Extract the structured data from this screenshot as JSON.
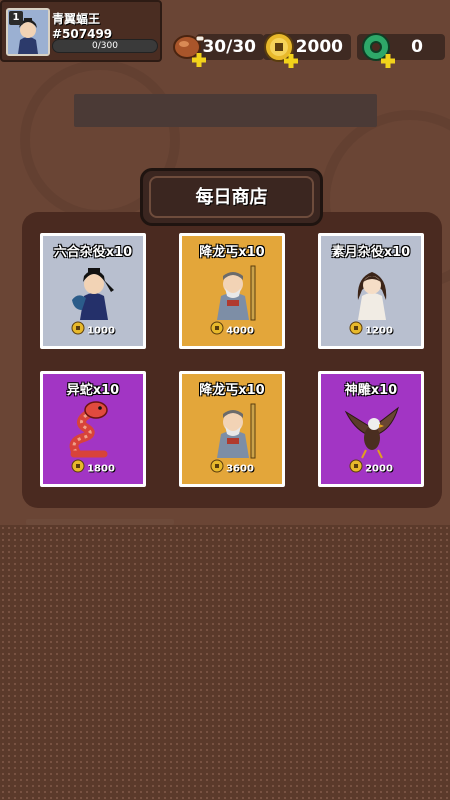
{
  "player": {
    "level": "1",
    "name": "青翼蝠王#507499",
    "xp_text": "0/300",
    "xp_progress": 0
  },
  "resources": {
    "stamina": {
      "icon": "meat-icon",
      "value": "30/30"
    },
    "coins": {
      "icon": "coin-icon",
      "value": "2000"
    },
    "gems": {
      "icon": "jade-icon",
      "value": "0"
    }
  },
  "shop": {
    "title": "每日商店",
    "items": [
      {
        "name": "六合杂役x10",
        "price": "1000",
        "rarity": "gray",
        "art": "swordsman-icon"
      },
      {
        "name": "降龙丐x10",
        "price": "4000",
        "rarity": "gold",
        "art": "beggar-elder-icon"
      },
      {
        "name": "素月杂役x10",
        "price": "1200",
        "rarity": "gray",
        "art": "maiden-icon"
      },
      {
        "name": "异蛇x10",
        "price": "1800",
        "rarity": "purple",
        "art": "snake-icon"
      },
      {
        "name": "降龙丐x10",
        "price": "3600",
        "rarity": "gold",
        "art": "beggar-elder-icon"
      },
      {
        "name": "神雕x10",
        "price": "2000",
        "rarity": "purple",
        "art": "eagle-icon"
      }
    ]
  },
  "colors": {
    "gray_card": "#b8bfcf",
    "gold_card": "#e3a63a",
    "purple_card": "#a235c4",
    "plus_badge": "#f2d21b"
  }
}
